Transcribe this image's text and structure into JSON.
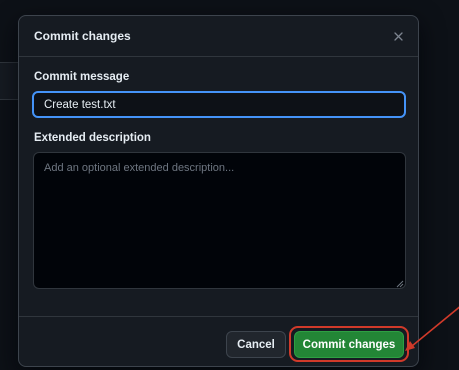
{
  "dialog": {
    "title": "Commit changes",
    "close_icon": "close-icon"
  },
  "commit_message": {
    "label": "Commit message",
    "value": "Create test.txt"
  },
  "extended_description": {
    "label": "Extended description",
    "placeholder": "Add an optional extended description..."
  },
  "footer": {
    "cancel_label": "Cancel",
    "commit_label": "Commit changes"
  },
  "colors": {
    "background": "#0d1117",
    "dialog": "#161b22",
    "accent_focus": "#4493f8",
    "commit_green": "#238636",
    "annotation_red": "#d13a2a"
  }
}
